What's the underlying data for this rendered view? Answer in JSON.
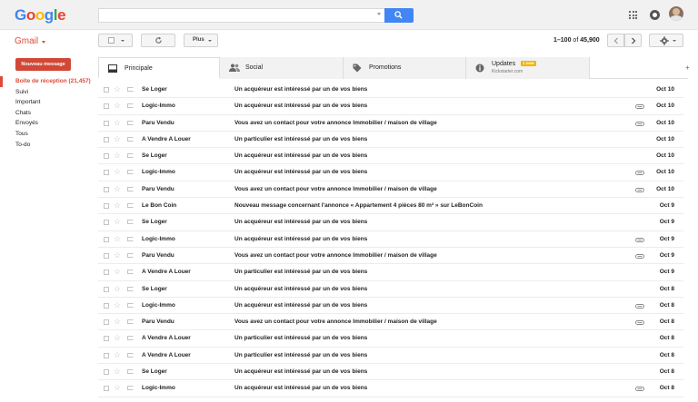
{
  "header": {
    "logo": [
      "G",
      "o",
      "o",
      "g",
      "l",
      "e"
    ],
    "logo_colors": [
      "#4285f4",
      "#ea4335",
      "#fbbc05",
      "#4285f4",
      "#34a853",
      "#ea4335"
    ],
    "search_placeholder": ""
  },
  "toolbar": {
    "app_label": "Gmail",
    "more_label": "Plus",
    "range": "1–100",
    "of": "of",
    "total": "45,900"
  },
  "sidebar": {
    "compose_label": "Nouveau message",
    "items": [
      {
        "label": "Boîte de réception (21,457)",
        "active": true
      },
      {
        "label": "Suivi"
      },
      {
        "label": "Important"
      },
      {
        "label": "Chats"
      },
      {
        "label": "Envoyés"
      },
      {
        "label": "Tous"
      },
      {
        "label": "To-do"
      }
    ]
  },
  "tabs": [
    {
      "label": "Principale",
      "icon": "inbox-icon"
    },
    {
      "label": "Social",
      "icon": "people-icon"
    },
    {
      "label": "Promotions",
      "icon": "tag-icon"
    },
    {
      "label": "Updates",
      "icon": "info-icon",
      "badge": "1 new",
      "sub": "Kickstarter.com"
    }
  ],
  "emails": [
    {
      "sender": "Se Loger",
      "subject": "Un acquéreur est intéressé par un de vos biens",
      "date": "Oct 10",
      "attachment": false
    },
    {
      "sender": "Logic-Immo",
      "subject": "Un acquéreur est intéressé par un de vos biens",
      "date": "Oct 10",
      "attachment": true
    },
    {
      "sender": "Paru Vendu",
      "subject": "Vous avez un contact pour votre annonce Immobilier / maison de village",
      "date": "Oct 10",
      "attachment": true
    },
    {
      "sender": "A Vendre A Louer",
      "subject": "Un particulier est intéressé par un de vos biens",
      "date": "Oct 10",
      "attachment": false
    },
    {
      "sender": "Se Loger",
      "subject": "Un acquéreur est intéressé par un de vos biens",
      "date": "Oct 10",
      "attachment": false
    },
    {
      "sender": "Logic-Immo",
      "subject": "Un acquéreur est intéressé par un de vos biens",
      "date": "Oct 10",
      "attachment": true
    },
    {
      "sender": "Paru Vendu",
      "subject": "Vous avez un contact pour votre annonce Immobilier / maison de village",
      "date": "Oct 10",
      "attachment": true
    },
    {
      "sender": "Le Bon Coin",
      "subject": "Nouveau message concernant l'annonce « Appartement 4 pièces 80 m² » sur LeBonCoin",
      "date": "Oct 9",
      "attachment": false
    },
    {
      "sender": "Se Loger",
      "subject": "Un acquéreur est intéressé par un de vos biens",
      "date": "Oct 9",
      "attachment": false
    },
    {
      "sender": "Logic-Immo",
      "subject": "Un acquéreur est intéressé par un de vos biens",
      "date": "Oct 9",
      "attachment": true
    },
    {
      "sender": "Paru Vendu",
      "subject": "Vous avez un contact pour votre annonce Immobilier / maison de village",
      "date": "Oct 9",
      "attachment": true
    },
    {
      "sender": "A Vendre A Louer",
      "subject": "Un particulier est intéressé par un de vos biens",
      "date": "Oct 9",
      "attachment": false
    },
    {
      "sender": "Se Loger",
      "subject": "Un acquéreur est intéressé par un de vos biens",
      "date": "Oct 8",
      "attachment": false
    },
    {
      "sender": "Logic-Immo",
      "subject": "Un acquéreur est intéressé par un de vos biens",
      "date": "Oct 8",
      "attachment": true
    },
    {
      "sender": "Paru Vendu",
      "subject": "Vous avez un contact pour votre annonce Immobilier / maison de village",
      "date": "Oct 8",
      "attachment": true
    },
    {
      "sender": "A Vendre A Louer",
      "subject": "Un particulier est intéressé par un de vos biens",
      "date": "Oct 8",
      "attachment": false
    },
    {
      "sender": "A Vendre A Louer",
      "subject": "Un particulier est intéressé par un de vos biens",
      "date": "Oct 8",
      "attachment": false
    },
    {
      "sender": "Se Loger",
      "subject": "Un acquéreur est intéressé par un de vos biens",
      "date": "Oct 8",
      "attachment": false
    },
    {
      "sender": "Logic-Immo",
      "subject": "Un acquéreur est intéressé par un de vos biens",
      "date": "Oct 8",
      "attachment": true
    }
  ]
}
